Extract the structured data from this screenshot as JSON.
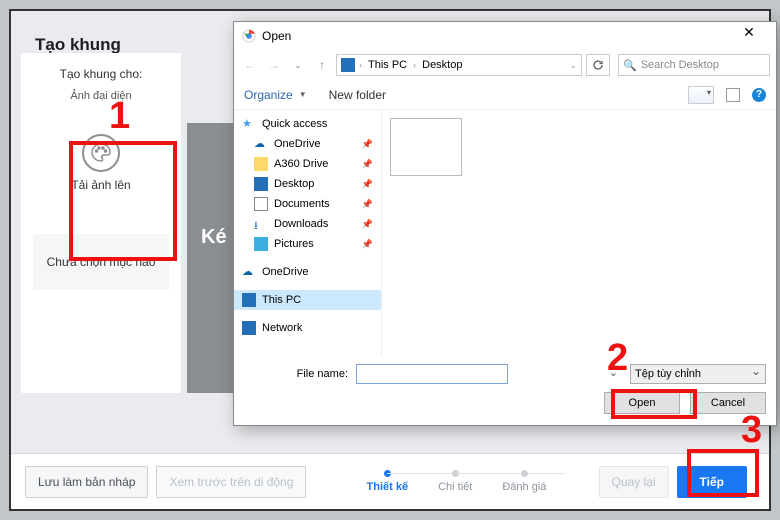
{
  "page": {
    "title": "Tạo khung",
    "subtitle": "Tạo khung cho:",
    "subtitle2": "Ảnh đại diện",
    "upload_label": "Tải ảnh lên",
    "no_selection": "Chưa chọn mục nào",
    "center_snip": "Ké"
  },
  "bottom": {
    "draft": "Lưu làm bản nháp",
    "preview": "Xem trước trên di động",
    "back": "Quay lại",
    "next": "Tiếp",
    "steps": [
      "Thiết kế",
      "Chi tiết",
      "Đánh giá"
    ]
  },
  "dialog": {
    "title": "Open",
    "path": {
      "root": "This PC",
      "folder": "Desktop"
    },
    "search_placeholder": "Search Desktop",
    "organize": "Organize",
    "new_folder": "New folder",
    "tree": {
      "quick": "Quick access",
      "items": [
        {
          "label": "OneDrive",
          "icon": "cloud"
        },
        {
          "label": "A360 Drive",
          "icon": "folder-y"
        },
        {
          "label": "Desktop",
          "icon": "desktop-b"
        },
        {
          "label": "Documents",
          "icon": "doc-i"
        },
        {
          "label": "Downloads",
          "icon": "down-i"
        },
        {
          "label": "Pictures",
          "icon": "pic-i"
        }
      ],
      "onedrive2": "OneDrive",
      "thispc": "This PC",
      "network": "Network"
    },
    "file_name_label": "File name:",
    "filter": "Tệp tùy chỉnh",
    "open": "Open",
    "cancel": "Cancel"
  },
  "annotations": {
    "n1": "1",
    "n2": "2",
    "n3": "3"
  }
}
